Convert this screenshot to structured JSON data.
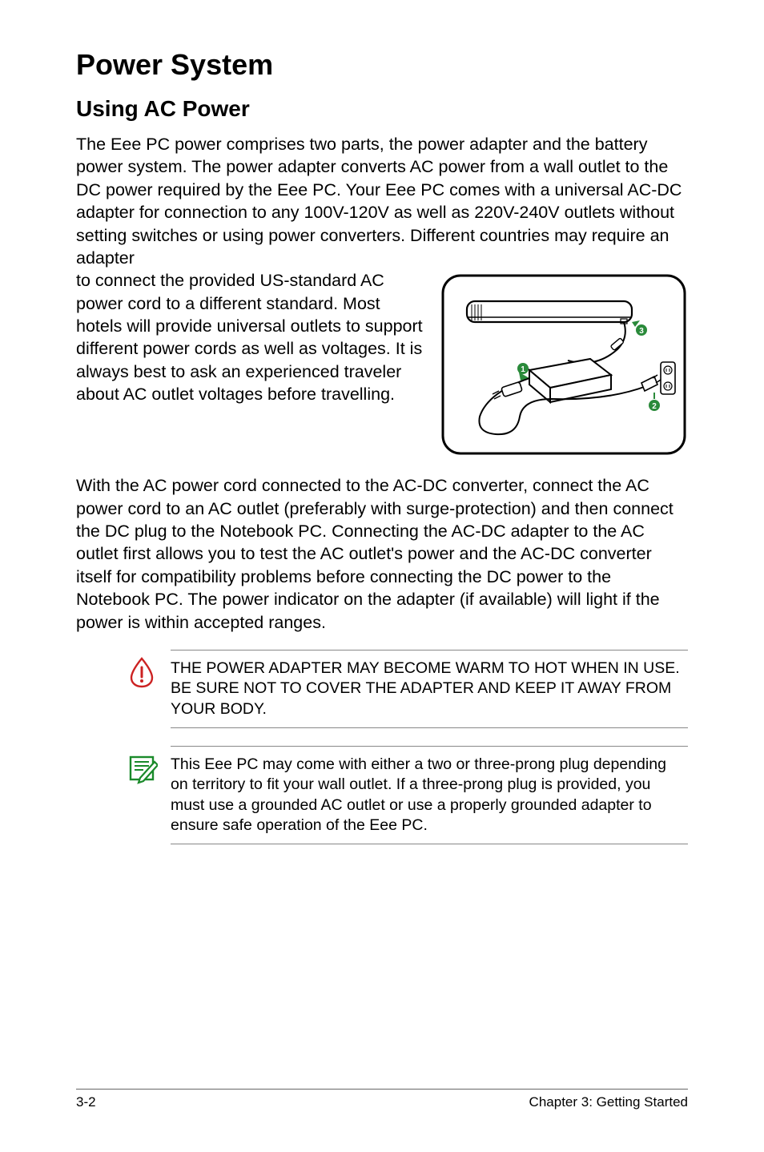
{
  "heading1": "Power System",
  "heading2": "Using AC Power",
  "para1_part1": "The Eee PC power comprises two parts, the power adapter and the battery power system. The power adapter converts AC power from a wall outlet to the DC power required by the Eee PC. Your Eee PC comes with a universal AC-DC adapter for connection to any 100V-120V as well as 220V-240V outlets without setting switches or using power converters. Different countries may require an adapter ",
  "para1_part2": "to connect the provided US-standard AC power cord to a different standard. Most hotels will provide universal outlets to support different power cords as well as voltages. It is always best to ask an experienced traveler about AC outlet voltages before travelling.",
  "para2": "With the AC power cord connected to the AC-DC converter, connect the AC power cord to an AC outlet (preferably with surge-protection) and then connect the DC plug to the Notebook PC. Connecting the AC-DC adapter to the AC outlet first allows you to test the AC outlet's power and the AC-DC converter itself for compatibility problems before connecting the DC power to the Notebook PC. The power indicator on the adapter (if available) will light if the power is within accepted ranges.",
  "callout_warning": "THE POWER ADAPTER MAY BECOME WARM TO HOT WHEN IN USE. BE SURE NOT TO COVER THE ADAPTER AND KEEP IT AWAY FROM YOUR BODY.",
  "callout_note": "This Eee PC may come with either a two or three-prong plug depending on territory to fit your wall outlet. If a three-prong plug is provided, you must use a grounded AC outlet or use a properly grounded adapter to ensure safe operation of the Eee PC.",
  "page_number": "3-2",
  "chapter_label": "Chapter 3: Getting Started",
  "diagram": {
    "marker1": "1",
    "marker2": "2",
    "marker3": "3"
  }
}
